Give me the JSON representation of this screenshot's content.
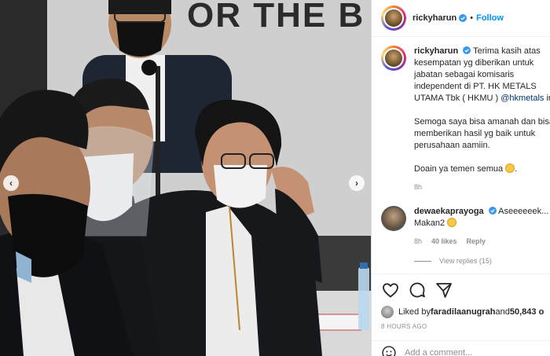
{
  "photo": {
    "background_text": "OR THE B",
    "alt": "photo"
  },
  "header": {
    "username": "rickyharun",
    "follow_label": "Follow",
    "separator": "•"
  },
  "caption": {
    "username": "rickyharun",
    "lines": [
      "Terima kasih atas",
      "kesempatan yg diberikan untuk",
      "jabatan sebagai komisaris",
      "independent di PT. HK METALS",
      "UTAMA Tbk ( HKMU ) "
    ],
    "mention": "@hkmetals",
    "mention_tail": " in",
    "para2": [
      "Semoga saya bisa amanah dan bisa",
      "memberikan hasil yg baik untuk",
      "perusahaan aamiin."
    ],
    "para3": "Doain ya temen semua ",
    "para3_tail": ".",
    "time": "8h"
  },
  "comment": {
    "username": "dewaekaprayoga",
    "text": "Aseeeeeek...",
    "text2": "Makan2 ",
    "time": "8h",
    "likes": "40 likes",
    "reply": "Reply",
    "view_replies": "View replies (15)"
  },
  "likes": {
    "prefix": "Liked by ",
    "user": "faradilaanugrah",
    "and": " and ",
    "others": "50,843 o"
  },
  "posted_ago": "8 HOURS AGO",
  "add_comment_placeholder": "Add a comment...",
  "colors": {
    "accent": "#0095f6",
    "verified": "#3897f0",
    "muted": "#8e8e8e"
  }
}
